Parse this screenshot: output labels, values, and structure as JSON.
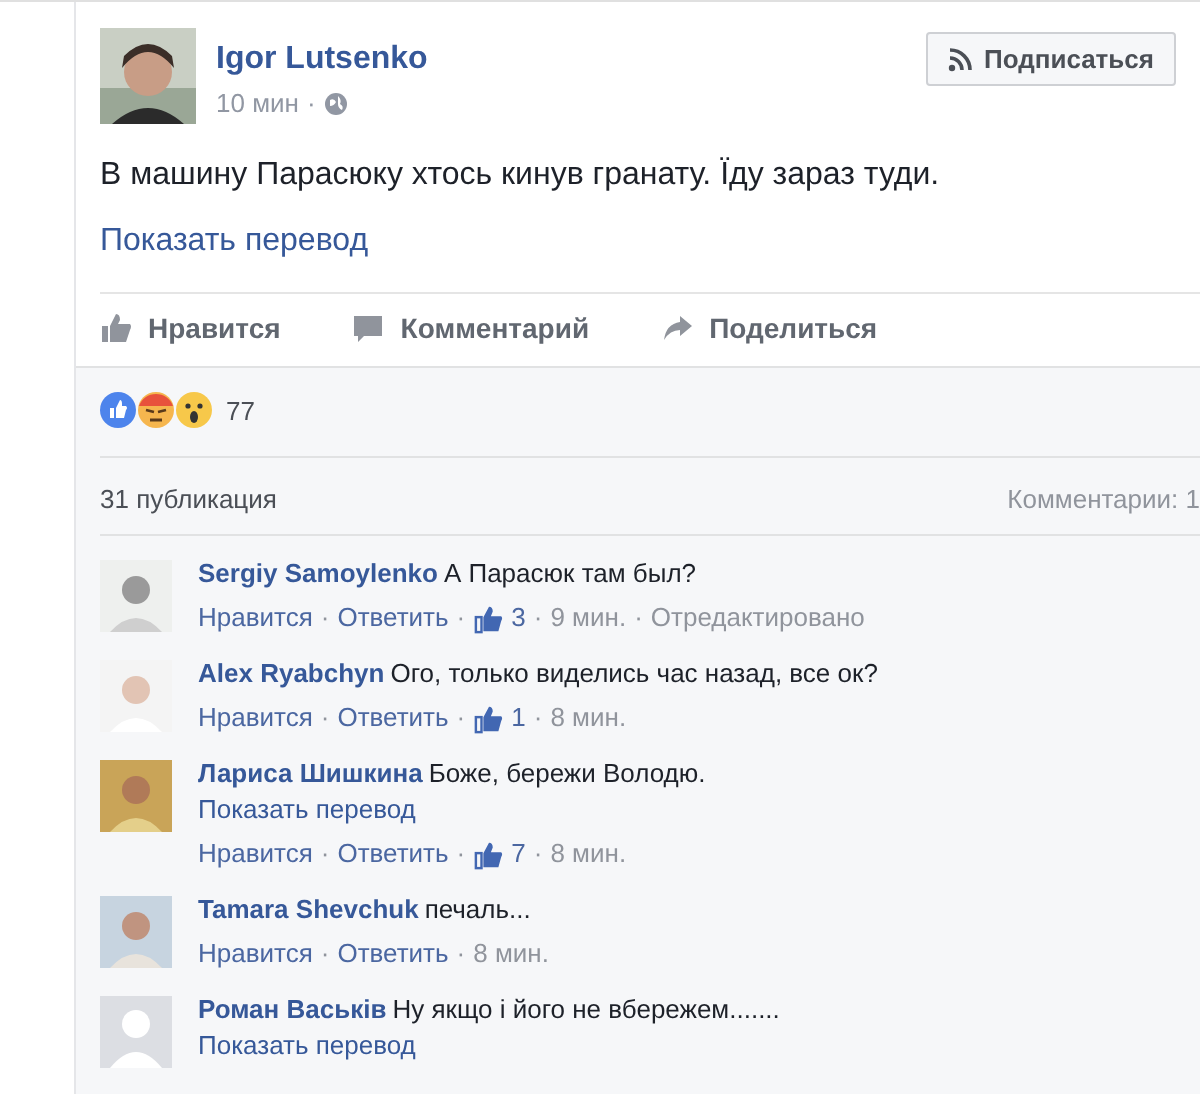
{
  "post": {
    "author": "Igor Lutsenko",
    "time": "10 мин",
    "separator": "·",
    "follow_button": "Подписаться",
    "text": "В машину Парасюку хтось кинув гранату. Їду зараз туди.",
    "translate_link": "Показать перевод"
  },
  "actions": [
    "Нравится",
    "Комментарий",
    "Поделиться"
  ],
  "reactions": {
    "count": "77"
  },
  "stats": {
    "shares": "31 публикация",
    "comments": "Комментарии: 1"
  },
  "comments": [
    {
      "name": "Sergiy Samoylenko",
      "text": "А Парасюк там был?",
      "footer": [
        {
          "kind": "link",
          "text": "Нравится"
        },
        {
          "kind": "sep",
          "text": "·"
        },
        {
          "kind": "link",
          "text": "Ответить"
        },
        {
          "kind": "sep",
          "text": "·"
        },
        {
          "kind": "likes",
          "text": "3"
        },
        {
          "kind": "sep",
          "text": "·"
        },
        {
          "kind": "time",
          "text": "9 мин."
        },
        {
          "kind": "sep",
          "text": "·"
        },
        {
          "kind": "edited",
          "text": "Отредактировано"
        }
      ]
    },
    {
      "name": "Alex Ryabchyn",
      "text": "Ого, только виделись час назад, все ок?",
      "footer": [
        {
          "kind": "link",
          "text": "Нравится"
        },
        {
          "kind": "sep",
          "text": "·"
        },
        {
          "kind": "link",
          "text": "Ответить"
        },
        {
          "kind": "sep",
          "text": "·"
        },
        {
          "kind": "likes",
          "text": "1"
        },
        {
          "kind": "sep",
          "text": "·"
        },
        {
          "kind": "time",
          "text": "8 мин."
        }
      ]
    },
    {
      "name": "Лариса Шишкина",
      "text": "Боже, бережи Володю.",
      "translate": "Показать перевод",
      "footer": [
        {
          "kind": "link",
          "text": "Нравится"
        },
        {
          "kind": "sep",
          "text": "·"
        },
        {
          "kind": "link",
          "text": "Ответить"
        },
        {
          "kind": "sep",
          "text": "·"
        },
        {
          "kind": "likes",
          "text": "7"
        },
        {
          "kind": "sep",
          "text": "·"
        },
        {
          "kind": "time",
          "text": "8 мин."
        }
      ]
    },
    {
      "name": "Tamara Shevchuk",
      "text": "печаль...",
      "footer": [
        {
          "kind": "link",
          "text": "Нравится"
        },
        {
          "kind": "sep",
          "text": "·"
        },
        {
          "kind": "link",
          "text": "Ответить"
        },
        {
          "kind": "sep",
          "text": "·"
        },
        {
          "kind": "time",
          "text": "8 мин."
        }
      ]
    },
    {
      "kind": "default",
      "name": "Роман Васьків",
      "text": "Ну якщо і його не вбережем.......",
      "translate": "Показать перевод"
    }
  ]
}
